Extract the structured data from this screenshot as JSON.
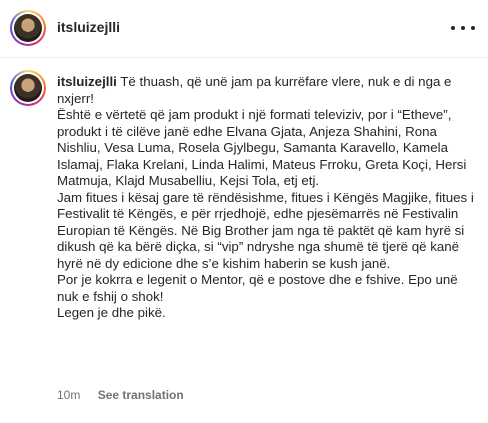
{
  "header": {
    "username": "itsluizejlli",
    "more_icon": "more-horizontal-icon"
  },
  "comment": {
    "username": "itsluizejlli",
    "text": " Të thuash, që unë jam pa kurrëfare vlere, nuk e di nga e nxjerr!\nËshtë e vërtetë që jam produkt i një formati televiziv, por i “Etheve”, produkt i të cilëve janë edhe Elvana Gjata, Anjeza Shahini, Rona Nishliu, Vesa Luma, Rosela Gjylbegu, Samanta Karavello, Kamela Islamaj, Flaka Krelani, Linda Halimi, Mateus Frroku, Greta Koçi, Hersi Matmuja, Klajd Musabelliu, Kejsi Tola, etj etj.\nJam fitues i kësaj gare të rëndësishme, fitues i Këngës Magjike, fitues i Festivalit të Këngës, e për rrjedhojë, edhe pjesëmarrës në Festivalin Europian të Këngës. Në Big Brother jam nga të paktët që kam hyrë si dikush që ka bërë diçka, si “vip” ndryshe nga shumë të tjerë që kanë hyrë në dy edicione dhe s’e kishim haberin se kush janë.\nPor je kokrra e legenit o Mentor, që e postove dhe e fshive. Epo unë nuk e fshij o shok!\nLegen je dhe pikë.",
    "time": "10m",
    "see_translation": "See translation"
  }
}
